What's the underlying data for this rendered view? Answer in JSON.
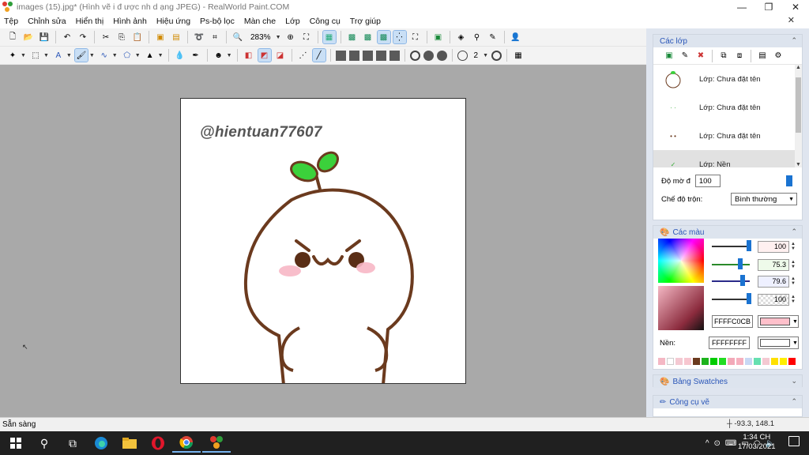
{
  "window": {
    "title": "images (15).jpg* (Hình vẽ i đ ược nh d ạng JPEG) - RealWorld Paint.COM",
    "controls": [
      "—",
      "❐",
      "✕"
    ]
  },
  "menu": [
    "Tệp",
    "Chỉnh sửa",
    "Hiển thị",
    "Hình ảnh",
    "Hiệu ứng",
    "Ps-bộ lọc",
    "Màn che",
    "Lớp",
    "Công cụ",
    "Trợ giúp"
  ],
  "toolbar": {
    "zoom": "283%",
    "brush_size": "2"
  },
  "canvas": {
    "watermark_text": "@hientuan77607"
  },
  "layers_panel": {
    "title": "Các lớp",
    "items": [
      {
        "label": "Lớp: Chưa đặt tên"
      },
      {
        "label": "Lớp: Chưa đặt tên"
      },
      {
        "label": "Lớp: Chưa đặt tên"
      },
      {
        "label": "Lớp: Nền"
      }
    ],
    "opacity_label": "Độ mờ đ",
    "opacity_value": "100",
    "blend_label": "Chế độ trộn:",
    "blend_value": "Bình thường"
  },
  "colors_panel": {
    "title": "Các màu",
    "values": [
      "100",
      "75.3",
      "79.6",
      "100"
    ],
    "primary_hex": "FFFFC0CB",
    "primary_color": "#FFC0CB",
    "bg_label": "Nền:",
    "bg_hex": "FFFFFFFF",
    "bg_color": "#FFFFFF",
    "palette": [
      "#f4b8c4",
      "#ffffff",
      "#f4c9d2",
      "#f7c6cf",
      "#6b3a1e",
      "#1db31d",
      "#00cc00",
      "#22dd22",
      "#f2a9b8",
      "#f6b0bf",
      "#c8d8f4",
      "#66e0b0",
      "#f4c9d2",
      "#ffe000",
      "#ffee00",
      "#ff0000"
    ]
  },
  "swatches_panel": {
    "title": "Bảng Swatches"
  },
  "tools_panel": {
    "title": "Công cụ vẽ"
  },
  "status": {
    "text": "Sẵn sàng",
    "coords": "-93.3, 148.1"
  },
  "taskbar": {
    "time": "1:34 CH",
    "date": "17/03/2021"
  }
}
